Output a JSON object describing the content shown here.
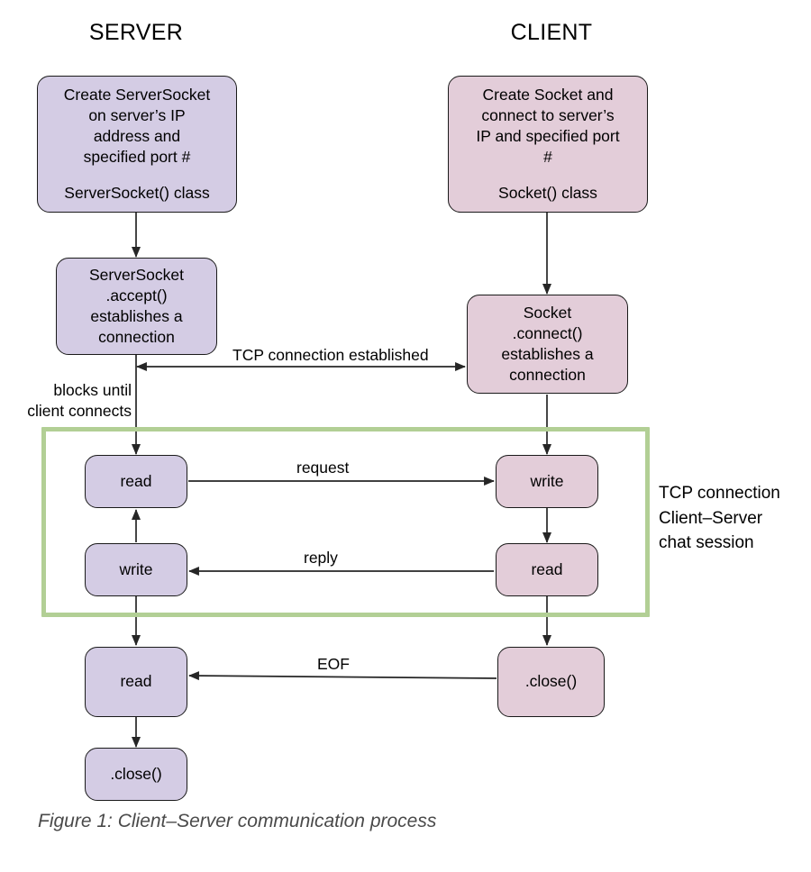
{
  "figure": {
    "caption": "Figure 1: Client–Server communication process",
    "columns": [
      {
        "name": "server",
        "title": "SERVER"
      },
      {
        "name": "client",
        "title": "CLIENT"
      }
    ],
    "colors": {
      "server_fill": "#d4cce4",
      "client_fill": "#e3cdd9",
      "node_stroke": "#1a1a1a",
      "session_border": "#b2cf95",
      "arrow": "#262626",
      "caption_text": "#4a4a4a",
      "background": "#ffffff"
    }
  },
  "nodes": {
    "server_create": {
      "lines": [
        "Create ServerSocket",
        "on server’s IP",
        "address and",
        "specified port #"
      ],
      "sub": "ServerSocket() class"
    },
    "server_accept": {
      "lines": [
        "ServerSocket",
        ".accept()",
        "establishes a",
        "connection"
      ]
    },
    "server_read_1": {
      "label": "read"
    },
    "server_write_1": {
      "label": "write"
    },
    "server_read_2": {
      "label": "read"
    },
    "server_close": {
      "label": ".close()"
    },
    "client_create": {
      "lines": [
        "Create Socket and",
        "connect to server’s",
        "IP and specified port",
        "#"
      ],
      "sub": "Socket() class"
    },
    "client_connect": {
      "lines": [
        "Socket",
        ".connect()",
        "establishes a",
        "connection"
      ]
    },
    "client_write_1": {
      "label": "write"
    },
    "client_read_1": {
      "label": "read"
    },
    "client_close": {
      "label": ".close()"
    }
  },
  "edge_labels": {
    "tcp_established": "TCP connection established",
    "blocks_until": [
      "blocks until",
      "client connects"
    ],
    "request": "request",
    "reply": "reply",
    "eof": "EOF"
  },
  "session": {
    "note_lines": [
      "TCP connection",
      "Client–Server",
      "chat session"
    ]
  }
}
